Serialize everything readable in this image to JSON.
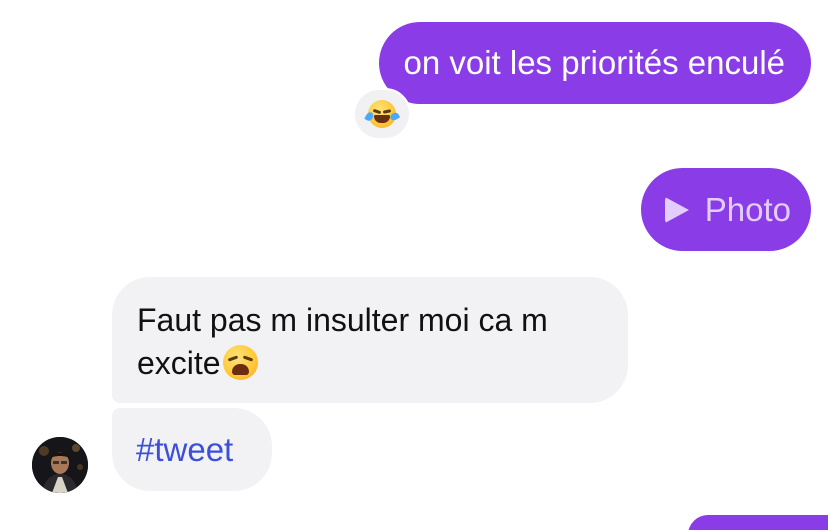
{
  "conversation": {
    "messages": [
      {
        "direction": "outgoing",
        "text": "on voit les priorités enculé",
        "reaction": "face-with-tears-of-joy"
      },
      {
        "direction": "outgoing",
        "type": "attachment",
        "icon": "play-icon",
        "label": "Photo"
      },
      {
        "direction": "incoming",
        "lines": [
          "Faut pas m insulter moi ca m",
          "excite"
        ],
        "emoji": "weary-face"
      },
      {
        "direction": "incoming",
        "text": "#tweet",
        "style": "hashtag-link"
      }
    ],
    "colors": {
      "outgoing_bubble": "#8a3de6",
      "incoming_bubble": "#f2f2f4",
      "hashtag": "#3b4fd9",
      "photo_label": "#e2cdfc"
    }
  }
}
